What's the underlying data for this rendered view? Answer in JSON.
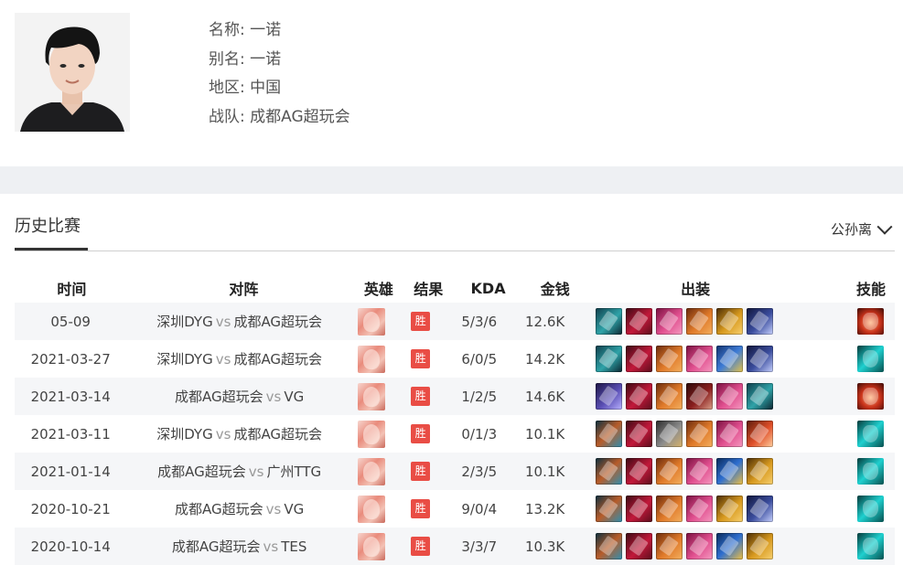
{
  "profile": {
    "name_label": "名称:",
    "name_value": "一诺",
    "alias_label": "别名:",
    "alias_value": "一诺",
    "region_label": "地区:",
    "region_value": "中国",
    "team_label": "战队:",
    "team_value": "成都AG超玩会"
  },
  "section": {
    "title": "历史比赛",
    "hero_filter": "公孙离"
  },
  "table": {
    "headers": {
      "time": "时间",
      "match": "对阵",
      "hero": "英雄",
      "result": "结果",
      "kda": "KDA",
      "gold": "金钱",
      "items": "出装",
      "skill": "技能"
    },
    "vs_text": "vs",
    "rows": [
      {
        "time": "05-09",
        "team_a": "深圳DYG",
        "team_b": "成都AG超玩会",
        "result": "胜",
        "kda": "5/3/6",
        "gold": "12.6K",
        "items": [
          "teal-gem-icon",
          "crimson-blade-icon",
          "pink-bow-icon",
          "orange-bow-icon",
          "gold-armor-icon",
          "dark-blade-icon"
        ],
        "skill": "red-flame-skill-icon"
      },
      {
        "time": "2021-03-27",
        "team_a": "深圳DYG",
        "team_b": "成都AG超玩会",
        "result": "胜",
        "kda": "6/0/5",
        "gold": "14.2K",
        "items": [
          "teal-gem-icon",
          "crimson-blade-icon",
          "orange-bow-icon",
          "pink-bow-icon",
          "blue-gold-armor-icon",
          "dark-blade-icon"
        ],
        "skill": "cyan-purify-skill-icon"
      },
      {
        "time": "2021-03-14",
        "team_a": "成都AG超玩会",
        "team_b": "VG",
        "result": "胜",
        "kda": "1/2/5",
        "gold": "14.6K",
        "items": [
          "purple-blade-icon",
          "crimson-blade-icon",
          "orange-bow-icon",
          "red-dagger-icon",
          "pink-bow-icon",
          "teal-gem-icon"
        ],
        "skill": "red-flame-skill-icon"
      },
      {
        "time": "2021-03-11",
        "team_a": "深圳DYG",
        "team_b": "成都AG超玩会",
        "result": "胜",
        "kda": "0/1/3",
        "gold": "10.1K",
        "items": [
          "blue-boots-icon",
          "crimson-blade-icon",
          "silver-armor-icon",
          "orange-bow-icon",
          "pink-bow-icon",
          "red-arrow-icon"
        ],
        "skill": "cyan-purify-skill-icon"
      },
      {
        "time": "2021-01-14",
        "team_a": "成都AG超玩会",
        "team_b": "广州TTG",
        "result": "胜",
        "kda": "2/3/5",
        "gold": "10.1K",
        "items": [
          "blue-boots-icon",
          "crimson-blade-icon",
          "orange-bow-icon",
          "pink-bow-icon",
          "gold-gem-icon",
          "gold-armor-icon"
        ],
        "skill": "cyan-purify-skill-icon"
      },
      {
        "time": "2020-10-21",
        "team_a": "成都AG超玩会",
        "team_b": "VG",
        "result": "胜",
        "kda": "9/0/4",
        "gold": "13.2K",
        "items": [
          "blue-boots-icon",
          "crimson-blade-icon",
          "orange-bow-icon",
          "pink-bow-icon",
          "gold-armor-icon",
          "dark-blade-icon"
        ],
        "skill": "cyan-purify-skill-icon"
      },
      {
        "time": "2020-10-14",
        "team_a": "成都AG超玩会",
        "team_b": "TES",
        "result": "胜",
        "kda": "3/3/7",
        "gold": "10.3K",
        "items": [
          "blue-boots-icon",
          "crimson-blade-icon",
          "orange-bow-icon",
          "pink-bow-icon",
          "gold-gem-icon",
          "gold-armor-icon"
        ],
        "skill": "cyan-purify-skill-icon"
      }
    ]
  },
  "colors": {
    "win_badge": "#e94d45",
    "band": "#eef0f3",
    "row_alt": "#f5f6f8"
  }
}
